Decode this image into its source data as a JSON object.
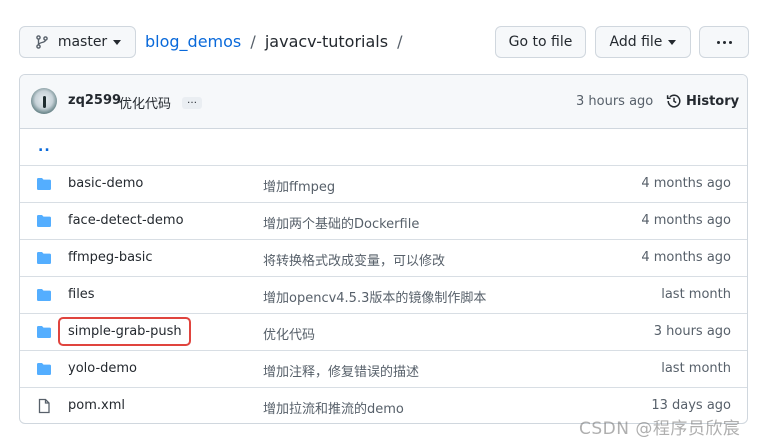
{
  "toolbar": {
    "branch_label": "master",
    "breadcrumb": {
      "repo": "blog_demos",
      "folder": "javacv-tutorials",
      "separator": "/"
    },
    "goto_file_label": "Go to file",
    "add_file_label": "Add file"
  },
  "commit": {
    "author": "zq2599",
    "message": "优化代码",
    "ellipsis": "…",
    "time": "3 hours ago",
    "history_label": "History"
  },
  "parent_link": "..",
  "files": [
    {
      "type": "folder",
      "icon": "folder-icon",
      "name": "basic-demo",
      "message": "增加ffmpeg",
      "age": "4 months ago"
    },
    {
      "type": "folder",
      "icon": "folder-icon",
      "name": "face-detect-demo",
      "message": "增加两个基础的Dockerfile",
      "age": "4 months ago"
    },
    {
      "type": "folder",
      "icon": "folder-icon",
      "name": "ffmpeg-basic",
      "message": "将转换格式改成变量，可以修改",
      "age": "4 months ago"
    },
    {
      "type": "folder",
      "icon": "folder-icon",
      "name": "files",
      "message": "增加opencv4.5.3版本的镜像制作脚本",
      "age": "last month"
    },
    {
      "type": "folder",
      "icon": "folder-icon",
      "name": "simple-grab-push",
      "message": "优化代码",
      "age": "3 hours ago"
    },
    {
      "type": "folder",
      "icon": "folder-icon",
      "name": "yolo-demo",
      "message": "增加注释，修复错误的描述",
      "age": "last month"
    },
    {
      "type": "file",
      "icon": "file-icon",
      "name": "pom.xml",
      "message": "增加拉流和推流的demo",
      "age": "13 days ago"
    }
  ],
  "watermark": "CSDN @程序员欣宸",
  "colors": {
    "link": "#0969da",
    "folder": "#54aeff",
    "highlight": "#e0443e"
  }
}
